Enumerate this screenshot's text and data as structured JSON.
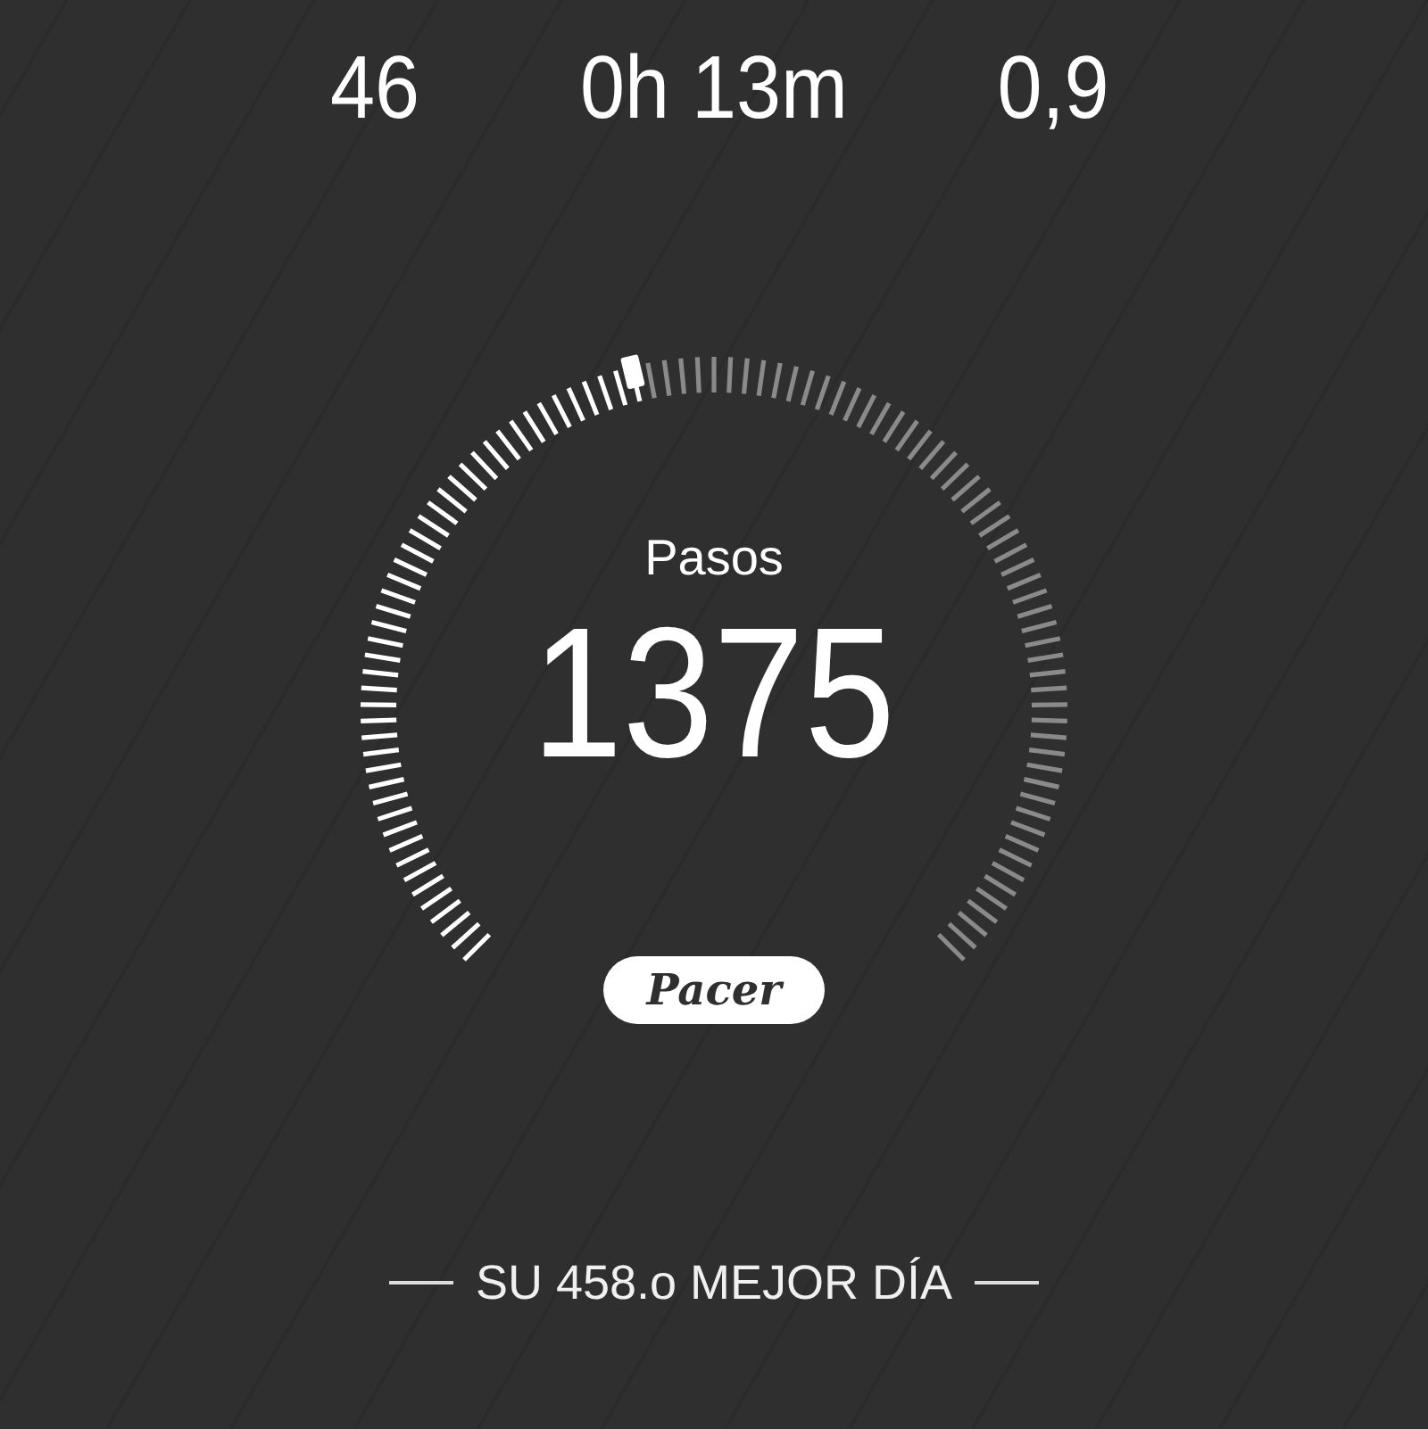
{
  "stats": [
    {
      "value": "46"
    },
    {
      "value": "0h 13m"
    },
    {
      "value": "0,9"
    }
  ],
  "gauge": {
    "label": "Pasos",
    "value": "1375"
  },
  "brand": "Pacer",
  "best_day": "SU 458.o MEJOR DÍA"
}
